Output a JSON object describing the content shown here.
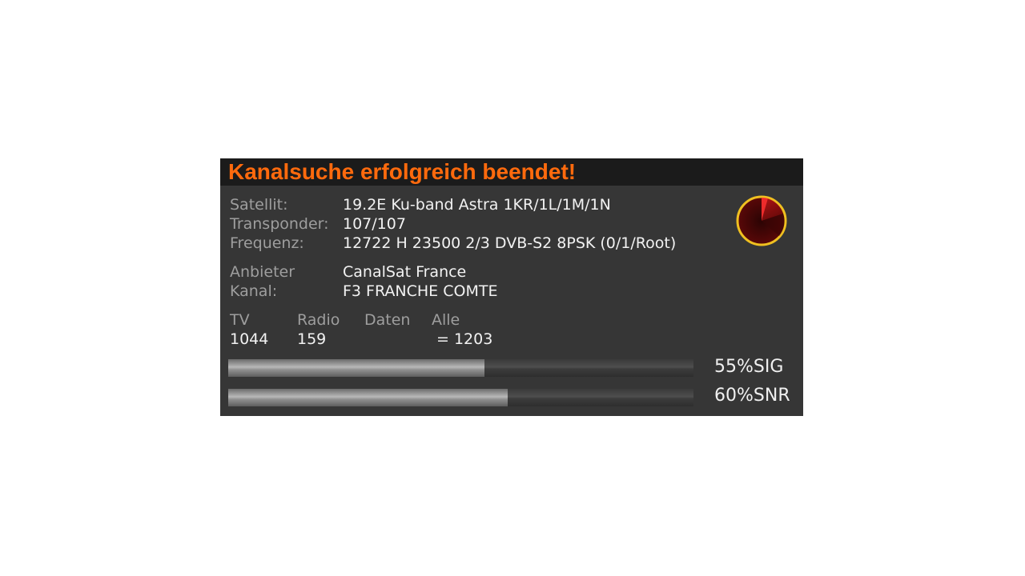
{
  "dialog": {
    "title": "Kanalsuche erfolgreich beendet!"
  },
  "info": {
    "satellite_label": "Satellit:",
    "satellite_value": "19.2E Ku-band Astra 1KR/1L/1M/1N",
    "transponder_label": "Transponder:",
    "transponder_value": "107/107",
    "frequency_label": "Frequenz:",
    "frequency_value": "12722 H 23500 2/3 DVB-S2 8PSK (0/1/Root)",
    "provider_label": "Anbieter",
    "provider_value": "CanalSat France",
    "channel_label": "Kanal:",
    "channel_value": "F3 FRANCHE COMTE"
  },
  "stats": {
    "tv_label": "TV",
    "radio_label": "Radio",
    "data_label": "Daten",
    "all_label": "Alle",
    "tv_value": "1044",
    "radio_value": "159",
    "all_value": "= 1203"
  },
  "signal": {
    "sig_percent": 55,
    "sig_text": "55%SIG",
    "snr_percent": 60,
    "snr_text": "60%SNR"
  },
  "colors": {
    "title": "#ff6a0d",
    "radar_ring": "#f0c020",
    "radar_fill": "#8a0c0c"
  },
  "icons": {
    "scan_indicator": "radar-icon"
  }
}
